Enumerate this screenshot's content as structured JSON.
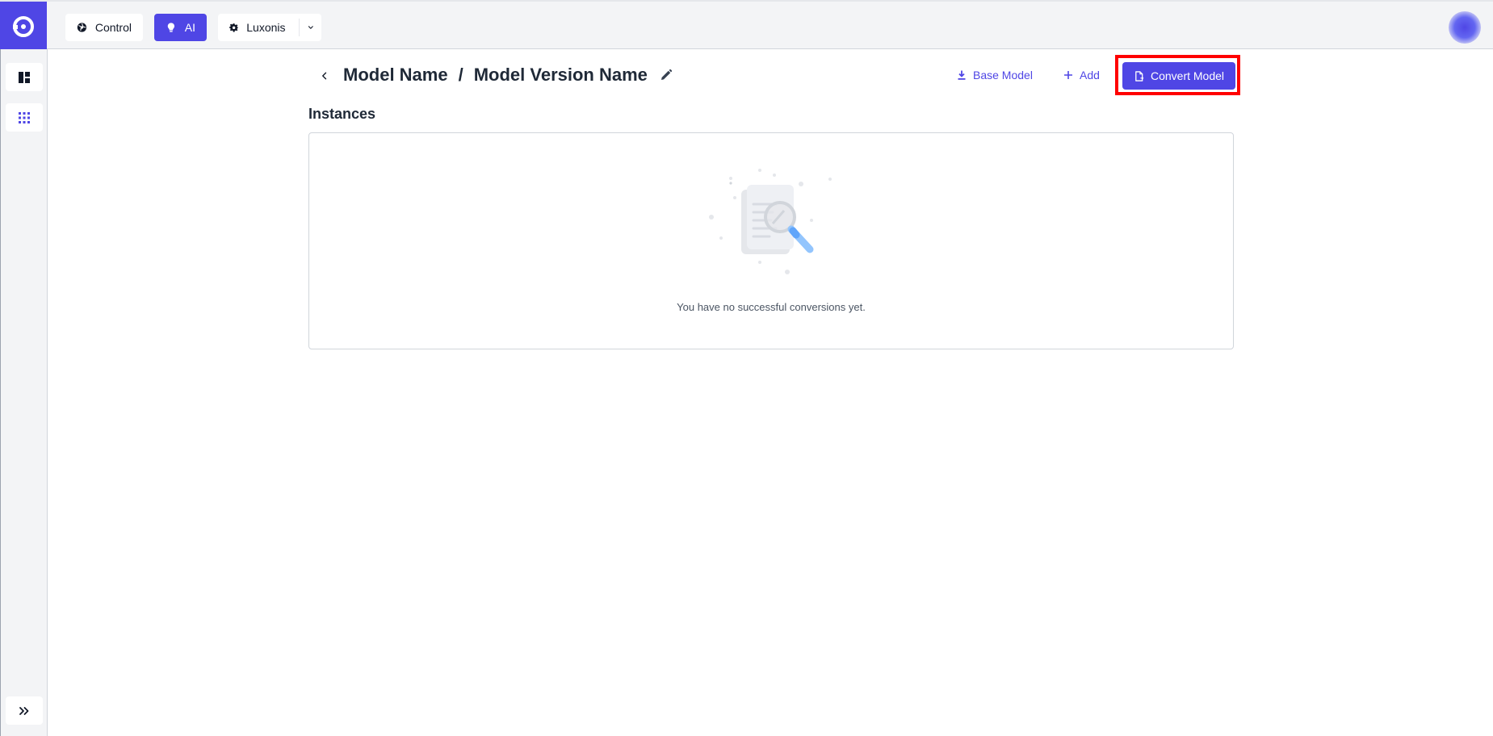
{
  "topbar": {
    "tabs": [
      {
        "label": "Control",
        "icon": "aperture-icon",
        "active": false
      },
      {
        "label": "AI",
        "icon": "lightbulb-icon",
        "active": true
      },
      {
        "label": "Luxonis",
        "icon": "gear-icon",
        "active": false
      }
    ],
    "dropdown_icon": "chevron-down-icon",
    "avatar": "user-avatar"
  },
  "sidebar": {
    "items": [
      {
        "icon": "dashboard-icon"
      },
      {
        "icon": "apps-grid-icon"
      }
    ],
    "expand_icon": "double-chevron-right-icon"
  },
  "page": {
    "breadcrumb_model": "Model Name",
    "breadcrumb_separator": "/",
    "breadcrumb_version": "Model Version Name",
    "actions": {
      "base_model_label": "Base Model",
      "add_label": "Add",
      "convert_label": "Convert Model"
    },
    "section_title": "Instances",
    "empty_message": "You have no successful conversions yet."
  },
  "colors": {
    "accent": "#4f46e5",
    "highlight": "#ff0000",
    "background": "#f3f4f6"
  }
}
